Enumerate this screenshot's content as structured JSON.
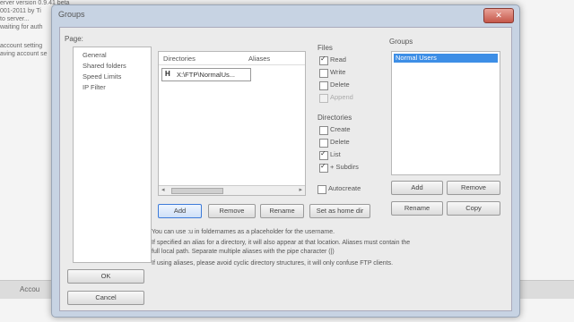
{
  "background": {
    "log_lines": [
      "erver version 0.9.41 beta",
      "001-2011 by Ti",
      "to server...",
      "waiting for auth",
      "account setting",
      "aving account se"
    ],
    "status_label": "Accou"
  },
  "dialog": {
    "title": "Groups",
    "close_glyph": "✕",
    "page_label": "Page:",
    "pages": [
      "General",
      "Shared folders",
      "Speed Limits",
      "IP Filter"
    ],
    "directories_header": "Directories",
    "aliases_header": "Aliases",
    "directory_home_marker": "H",
    "directory_path": "X:\\FTP\\NormalUs...",
    "dir_buttons": [
      "Add",
      "Remove",
      "Rename",
      "Set as home dir"
    ],
    "files_label": "Files",
    "files": [
      {
        "label": "Read",
        "checked": true,
        "disabled": false
      },
      {
        "label": "Write",
        "checked": false,
        "disabled": false
      },
      {
        "label": "Delete",
        "checked": false,
        "disabled": false
      },
      {
        "label": "Append",
        "checked": false,
        "disabled": true
      }
    ],
    "directories_label": "Directories",
    "directories": [
      {
        "label": "Create",
        "checked": false
      },
      {
        "label": "Delete",
        "checked": false
      },
      {
        "label": "List",
        "checked": true
      },
      {
        "label": "+ Subdirs",
        "checked": true
      }
    ],
    "autocreate_label": "Autocreate",
    "groups_label": "Groups",
    "groups": [
      "Normal Users"
    ],
    "group_buttons": [
      "Add",
      "Remove",
      "Rename",
      "Copy"
    ],
    "help_lines": [
      "You can use :u in foldernames as a placeholder for the username.",
      "If specified an alias for a directory, it will also appear at that location. Aliases must contain the",
      "full local path. Separate multiple aliases with the pipe character (|)",
      "If using aliases, please avoid cyclic directory structures, it will only confuse FTP clients."
    ],
    "ok_label": "OK",
    "cancel_label": "Cancel"
  }
}
